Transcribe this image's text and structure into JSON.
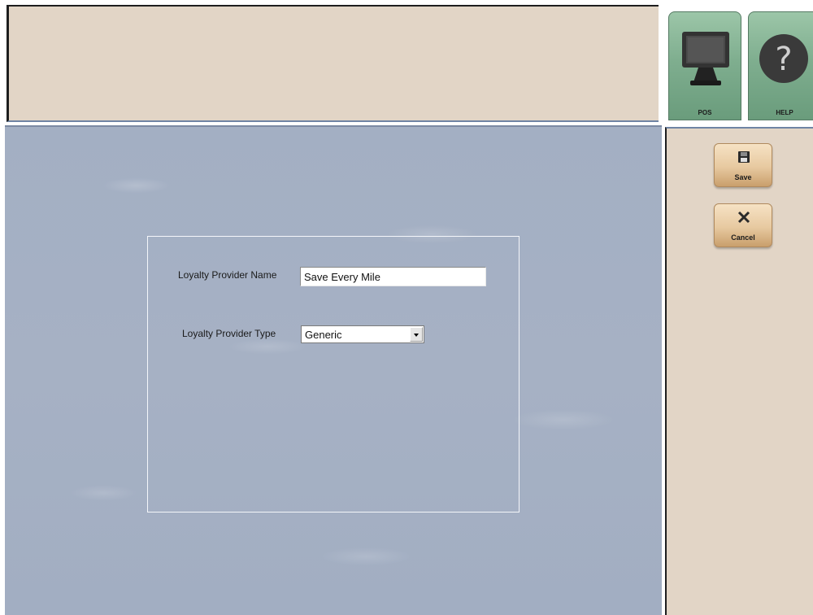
{
  "top_nav": {
    "pos_label": "POS",
    "help_label": "HELP"
  },
  "actions": {
    "save_label": "Save",
    "cancel_label": "Cancel"
  },
  "form": {
    "name_label": "Loyalty Provider Name",
    "name_value": "Save Every Mile",
    "type_label": "Loyalty Provider Type",
    "type_value": "Generic"
  },
  "icons": {
    "pos": "monitor-icon",
    "help": "question-mark-icon",
    "save": "floppy-disk-icon",
    "cancel": "x-icon"
  },
  "colors": {
    "banner_bg": "#e2d5c6",
    "work_area_bg": "#a3afc3",
    "nav_button_green": "#7fae8f",
    "action_button_tan": "#e7c9a0"
  }
}
